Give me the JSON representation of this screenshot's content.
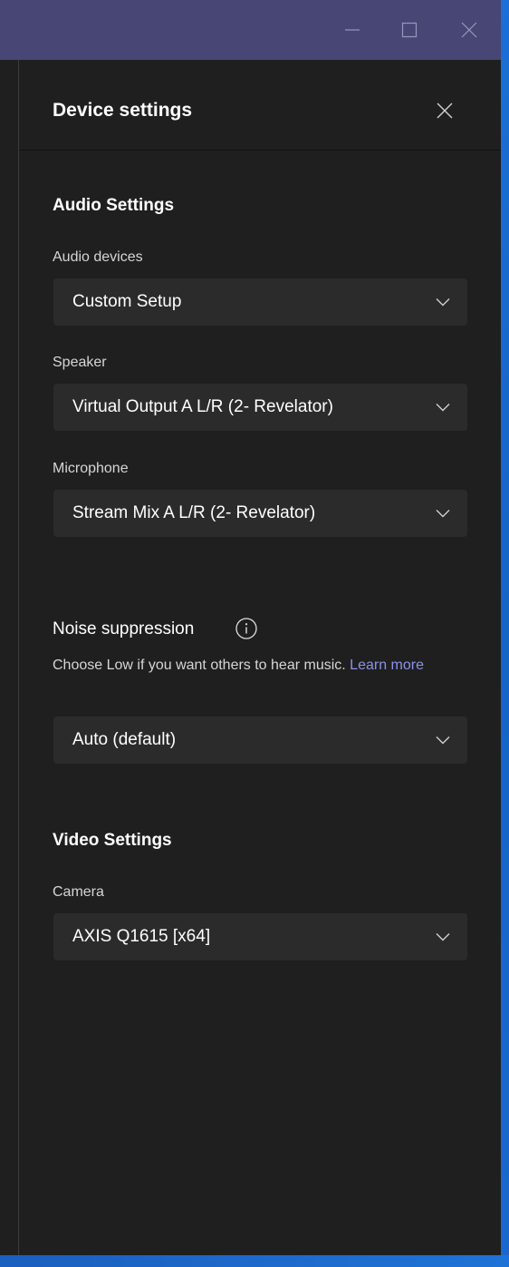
{
  "panel": {
    "title": "Device settings"
  },
  "audio": {
    "section_title": "Audio Settings",
    "devices_label": "Audio devices",
    "devices_value": "Custom Setup",
    "speaker_label": "Speaker",
    "speaker_value": "Virtual Output A L/R (2- Revelator)",
    "microphone_label": "Microphone",
    "microphone_value": "Stream Mix A L/R (2- Revelator)"
  },
  "noise": {
    "label": "Noise suppression",
    "help_text": "Choose Low if you want others to hear music.",
    "learn_more": "Learn more",
    "value": "Auto (default)"
  },
  "video": {
    "section_title": "Video Settings",
    "camera_label": "Camera",
    "camera_value": "AXIS Q1615 [x64]"
  },
  "icons": {
    "minimize": "minimize-icon",
    "maximize": "maximize-icon",
    "close_window": "close-icon",
    "close_panel": "close-icon",
    "chevron": "chevron-down-icon",
    "info": "info-icon"
  },
  "colors": {
    "titlebar": "#484674",
    "panel_bg": "#1f1f1f",
    "dropdown_bg": "#2b2b2b",
    "link": "#8b93e8",
    "desktop": "#1a5fc4"
  }
}
